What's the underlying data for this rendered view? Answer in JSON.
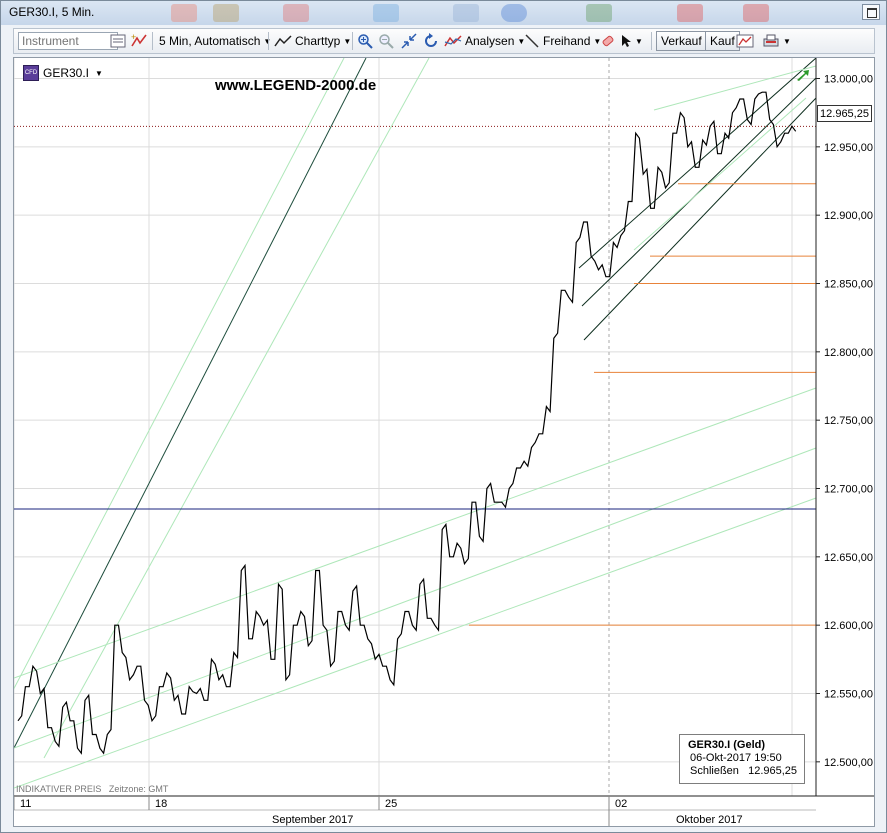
{
  "window": {
    "title": "GER30.I, 5 Min."
  },
  "toolbar": {
    "instrument_placeholder": "Instrument",
    "timeframe": "5 Min,  Automatisch",
    "charttyp": "Charttyp",
    "analysen": "Analysen",
    "freihand": "Freihand",
    "verkauf": "Verkauf",
    "kauf": "Kauf"
  },
  "chart": {
    "symbol": "GER30.I",
    "symbol_icon": "CFD",
    "watermark": "www.LEGEND-2000.de",
    "current_price": "12.965,25",
    "footer_left": "INDIKATIVER PREIS",
    "footer_tz": "Zeitzone: GMT",
    "info": {
      "title": "GER30.I (Geld)",
      "datetime": "06-Okt-2017 19:50",
      "close_label": "Schließen",
      "close_value": "12.965,25"
    }
  },
  "chart_data": {
    "type": "line",
    "ylim": [
      12475,
      13015
    ],
    "yticks": [
      "12.500,00",
      "12.550,00",
      "12.600,00",
      "12.650,00",
      "12.700,00",
      "12.750,00",
      "12.800,00",
      "12.850,00",
      "12.900,00",
      "12.950,00",
      "13.000,00"
    ],
    "yvalues": [
      12500,
      12550,
      12600,
      12650,
      12700,
      12750,
      12800,
      12850,
      12900,
      12950,
      13000
    ],
    "xtick_labels": [
      "11",
      "18",
      "25",
      "02"
    ],
    "month_labels": [
      "September 2017",
      "Oktober 2017"
    ],
    "horizontal_levels": [
      12965,
      12923,
      12870,
      12850,
      12785,
      12600,
      12685
    ],
    "series": [
      {
        "values": [
          12530,
          12555,
          12570,
          12550,
          12525,
          12515,
          12540,
          12530,
          12510,
          12545,
          12520,
          12510,
          12520,
          12600,
          12580,
          12560,
          12570,
          12545,
          12530,
          12555,
          12565,
          12545,
          12535,
          12555,
          12550,
          12545,
          12575,
          12560,
          12555,
          12580,
          12640,
          12590,
          12610,
          12600,
          12575,
          12630,
          12560,
          12600,
          12610,
          12585,
          12640,
          12600,
          12570,
          12610,
          12600,
          12625,
          12600,
          12590,
          12575,
          12570,
          12560,
          12590,
          12610,
          12600,
          12630,
          12605,
          12600,
          12670,
          12650,
          12660,
          12645,
          12690,
          12665,
          12700,
          12690,
          12690,
          12700,
          12715,
          12720,
          12730,
          12740,
          12760,
          12810,
          12845,
          12840,
          12880,
          12895,
          12870,
          12860,
          12855,
          12880,
          12885,
          12910,
          12960,
          12930,
          12905,
          12935,
          12920,
          12960,
          12975,
          12950,
          12935,
          12955,
          12965,
          12945,
          12960,
          12975,
          12985,
          12970,
          12985,
          12990,
          12970,
          12950,
          12960,
          12965
        ]
      }
    ]
  }
}
